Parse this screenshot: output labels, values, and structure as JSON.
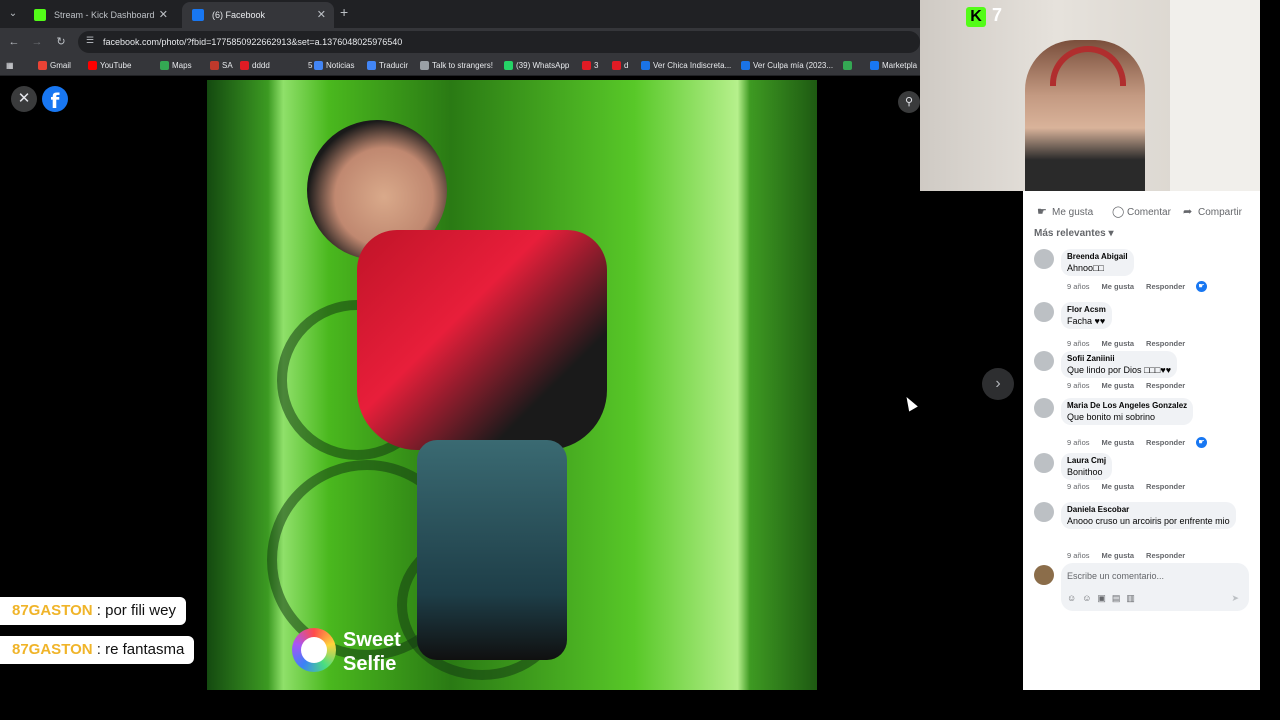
{
  "browser": {
    "tabs": [
      {
        "title": "Stream - Kick Dashboard",
        "favicon_color": "#53fc18",
        "active": false
      },
      {
        "title": "(6) Facebook",
        "favicon_color": "#1877f2",
        "active": true
      }
    ],
    "url": "facebook.com/photo/?fbid=1775850922662913&set=a.1376048025976540",
    "bookmarks": [
      {
        "label": "Gmail",
        "color": "#ea4335"
      },
      {
        "label": "YouTube",
        "color": "#ff0000"
      },
      {
        "label": "Maps",
        "color": "#34a853"
      },
      {
        "label": "SA",
        "color": "#c0392b"
      },
      {
        "label": "dddd",
        "color": "#e01b24"
      },
      {
        "label": "5",
        "color": "#35363a"
      },
      {
        "label": "Noticias",
        "color": "#4285f4"
      },
      {
        "label": "Traducir",
        "color": "#4285f4"
      },
      {
        "label": "Talk to strangers!",
        "color": "#9aa0a6"
      },
      {
        "label": "(39) WhatsApp",
        "color": "#25d366"
      },
      {
        "label": "3",
        "color": "#e01b24"
      },
      {
        "label": "d",
        "color": "#e01b24"
      },
      {
        "label": "Ver Chica Indiscreta...",
        "color": "#1a73e8"
      },
      {
        "label": "Ver Culpa mía (2023...",
        "color": "#1a73e8"
      },
      {
        "label": "",
        "color": "#34a853"
      },
      {
        "label": "Marketpla",
        "color": "#1877f2"
      }
    ]
  },
  "viewer": {
    "watermark_line1": "Sweet",
    "watermark_line2": "Selfie"
  },
  "stream": {
    "viewer_count": "7"
  },
  "comments_panel": {
    "actions": {
      "like": "Me gusta",
      "comment": "Comentar",
      "share": "Compartir"
    },
    "sort_label": "Más relevantes",
    "like_label": "Me gusta",
    "reply_label": "Responder",
    "comments": [
      {
        "author": "Breenda Abigail",
        "text": "Ahnoo□□",
        "age": "9 años",
        "liked": true
      },
      {
        "author": "Flor Acsm",
        "text": "Facha ♥♥",
        "age": "9 años",
        "liked": false
      },
      {
        "author": "Sofii Zaniinii",
        "text": "Que lindo por Dios □□□♥♥",
        "age": "9 años",
        "liked": false
      },
      {
        "author": "Maria De Los Angeles Gonzalez",
        "text": "Que bonito mi sobrino",
        "age": "9 años",
        "liked": true
      },
      {
        "author": "Laura Cmj",
        "text": "Bonithoo",
        "age": "9 años",
        "liked": false
      },
      {
        "author": "Daniela Escobar",
        "text": "Anooo cruso un arcoiris por enfrente mio",
        "age": "9 años",
        "liked": false
      }
    ],
    "composer_placeholder": "Escribe un comentario..."
  },
  "chat": [
    {
      "user": "87GASTON",
      "separator": " : ",
      "message": "por fili wey"
    },
    {
      "user": "87GASTON",
      "separator": " : ",
      "message": "re fantasma"
    }
  ]
}
